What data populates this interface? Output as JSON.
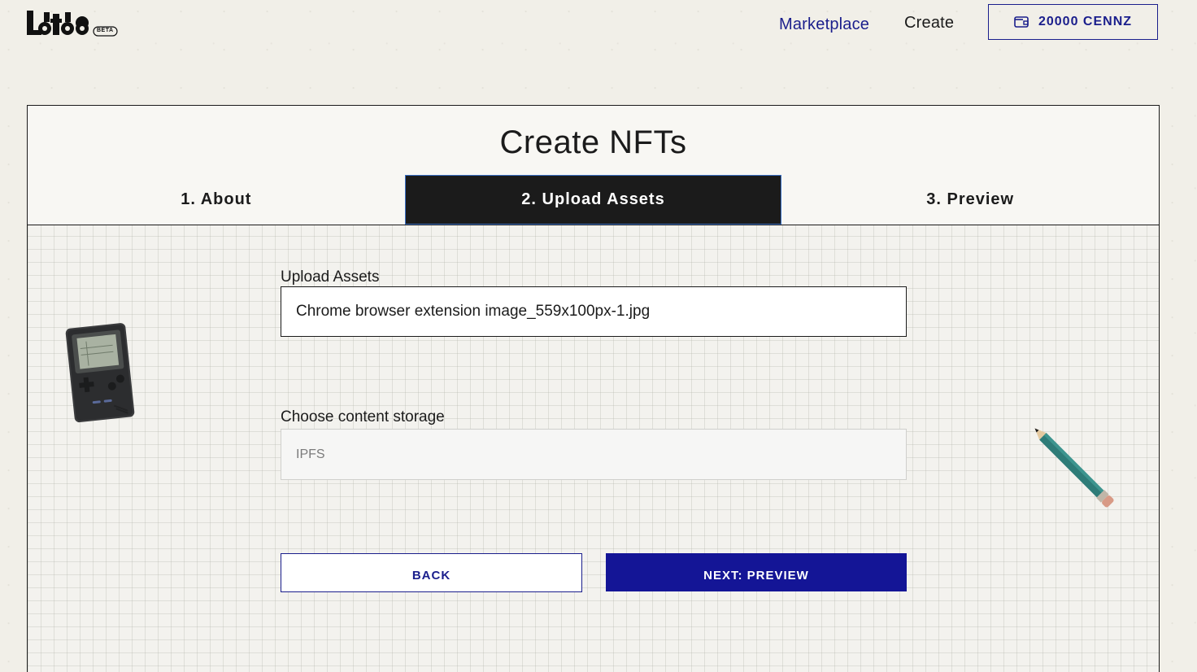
{
  "header": {
    "logo_badge": "BETA",
    "nav": {
      "marketplace": "Marketplace",
      "create": "Create"
    },
    "wallet": {
      "balance": "20000 CENNZ",
      "icon": "wallet-icon"
    }
  },
  "page": {
    "title": "Create NFTs",
    "steps": [
      {
        "label": "1. About",
        "active": false
      },
      {
        "label": "2. Upload Assets",
        "active": true
      },
      {
        "label": "3. Preview",
        "active": false
      }
    ],
    "form": {
      "upload_label": "Upload Assets",
      "upload_value": "Chrome browser extension image_559x100px-1.jpg",
      "storage_label": "Choose content storage",
      "storage_value": "IPFS"
    },
    "buttons": {
      "back": "BACK",
      "next": "NEXT: PREVIEW"
    }
  },
  "colors": {
    "accent": "#1a1e8c",
    "primary_button": "#141596",
    "active_step": "#1b1b1b",
    "background": "#f1efe8"
  }
}
